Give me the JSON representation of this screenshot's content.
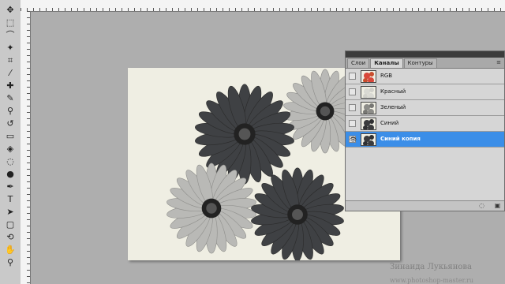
{
  "toolbar": {
    "tools": [
      {
        "name": "move-tool-icon",
        "glyph": "✥"
      },
      {
        "name": "marquee-tool-icon",
        "glyph": "⬚"
      },
      {
        "name": "lasso-tool-icon",
        "glyph": "⌒"
      },
      {
        "name": "magic-wand-tool-icon",
        "glyph": "✦"
      },
      {
        "name": "crop-tool-icon",
        "glyph": "⌗"
      },
      {
        "name": "eyedropper-tool-icon",
        "glyph": "⁄"
      },
      {
        "name": "healing-brush-tool-icon",
        "glyph": "✚"
      },
      {
        "name": "brush-tool-icon",
        "glyph": "✎"
      },
      {
        "name": "clone-stamp-tool-icon",
        "glyph": "⚲"
      },
      {
        "name": "history-brush-tool-icon",
        "glyph": "↺"
      },
      {
        "name": "eraser-tool-icon",
        "glyph": "▭"
      },
      {
        "name": "paint-bucket-tool-icon",
        "glyph": "◈"
      },
      {
        "name": "blur-tool-icon",
        "glyph": "◌"
      },
      {
        "name": "dodge-tool-icon",
        "glyph": "●"
      },
      {
        "name": "pen-tool-icon",
        "glyph": "✒"
      },
      {
        "name": "type-tool-icon",
        "glyph": "T"
      },
      {
        "name": "path-selection-tool-icon",
        "glyph": "➤"
      },
      {
        "name": "shape-tool-icon",
        "glyph": "▢"
      },
      {
        "name": "3d-rotate-tool-icon",
        "glyph": "⟲"
      },
      {
        "name": "hand-tool-icon",
        "glyph": "✋"
      },
      {
        "name": "zoom-tool-icon",
        "glyph": "⚲"
      }
    ]
  },
  "panel": {
    "tabs": [
      {
        "name": "tab-layers",
        "label": "Слои",
        "active": false
      },
      {
        "name": "tab-channels",
        "label": "Каналы",
        "active": true
      },
      {
        "name": "tab-paths",
        "label": "Контуры",
        "active": false
      }
    ],
    "menu_icon": "≡",
    "rows": [
      {
        "name": "channel-rgb",
        "label": "RGB",
        "thumb": "color",
        "visible": false,
        "selected": false
      },
      {
        "name": "channel-red",
        "label": "Красный",
        "thumb": "light",
        "visible": false,
        "selected": false
      },
      {
        "name": "channel-green",
        "label": "Зеленый",
        "thumb": "mid",
        "visible": false,
        "selected": false
      },
      {
        "name": "channel-blue",
        "label": "Синий",
        "thumb": "dark",
        "visible": false,
        "selected": false
      },
      {
        "name": "channel-blue-copy",
        "label": "Синий копия",
        "thumb": "dark",
        "visible": true,
        "selected": true
      }
    ],
    "bottom_buttons": [
      {
        "name": "load-channel-as-selection-icon",
        "glyph": "◌"
      },
      {
        "name": "save-selection-as-channel-icon",
        "glyph": "▣"
      }
    ]
  },
  "watermark": {
    "author": "Зинаида Лукьянова",
    "site": "www.photoshop-master.ru"
  },
  "colors": {
    "workspace": "#aeaeae",
    "canvas": "#efeee3",
    "selection": "#3b8ee8",
    "flower_dark": "#3f4144",
    "flower_light": "#b9b9b6"
  }
}
